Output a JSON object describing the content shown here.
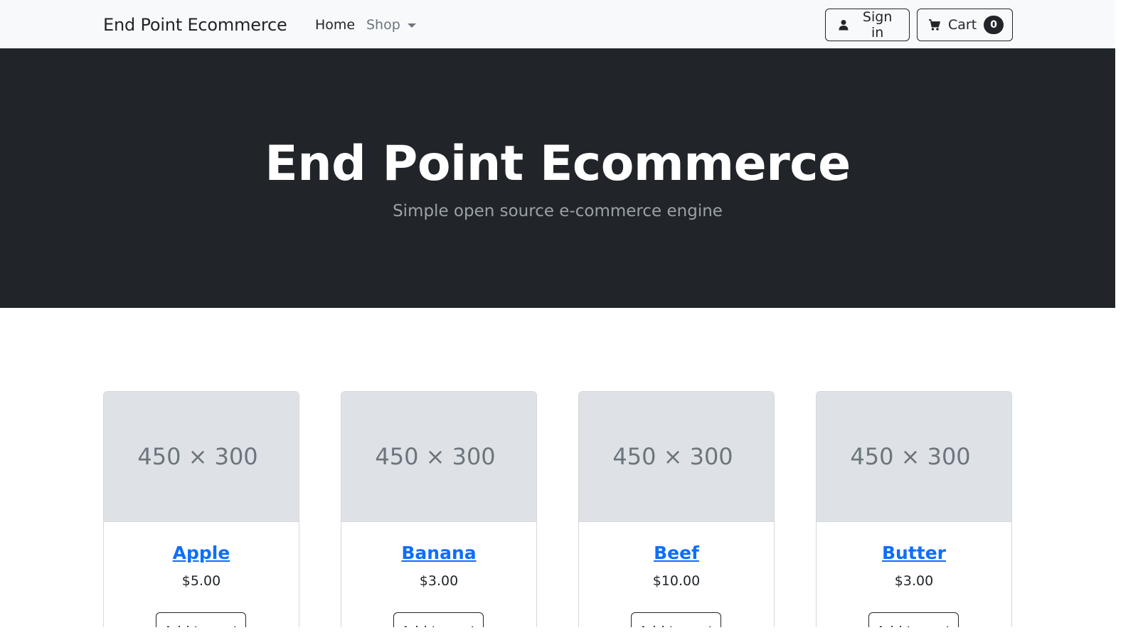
{
  "navbar": {
    "brand": "End Point Ecommerce",
    "links": {
      "home": "Home",
      "shop": "Shop"
    },
    "sign_in_label": "Sign in",
    "cart_label": "Cart",
    "cart_count": "0"
  },
  "hero": {
    "title": "End Point Ecommerce",
    "subtitle": "Simple open source e-commerce engine"
  },
  "products": [
    {
      "name": "Apple",
      "price": "$5.00",
      "placeholder": "450 × 300",
      "button_label": "Add to cart"
    },
    {
      "name": "Banana",
      "price": "$3.00",
      "placeholder": "450 × 300",
      "button_label": "Add to cart"
    },
    {
      "name": "Beef",
      "price": "$10.00",
      "placeholder": "450 × 300",
      "button_label": "Add to cart"
    },
    {
      "name": "Butter",
      "price": "$3.00",
      "placeholder": "450 × 300",
      "button_label": "Add to cart"
    }
  ],
  "colors": {
    "hero_background": "#212529",
    "navbar_background": "#f8f9fa",
    "link_blue": "#0d6efd",
    "placeholder_gray": "#dee2e6"
  },
  "icons": {
    "sign_in": "user-icon",
    "cart": "cart-icon",
    "shop_dropdown": "caret-down-icon"
  }
}
